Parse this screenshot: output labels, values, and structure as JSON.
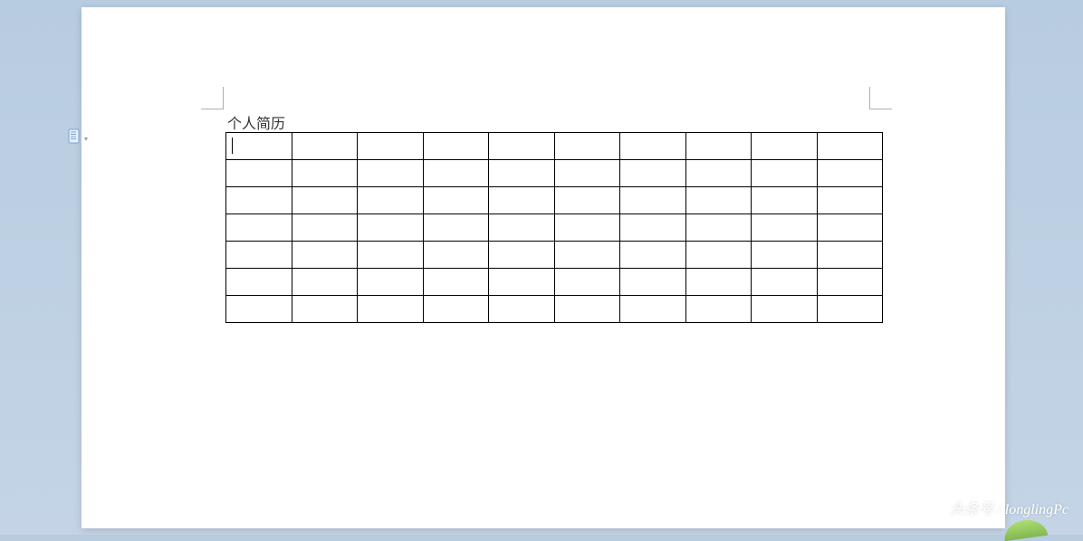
{
  "document": {
    "title": "个人简历",
    "table": {
      "rows": 7,
      "cols": 10
    }
  },
  "watermark": {
    "text": "头条号 / longlingPc"
  },
  "icons": {
    "newDoc": "new-document-icon"
  }
}
